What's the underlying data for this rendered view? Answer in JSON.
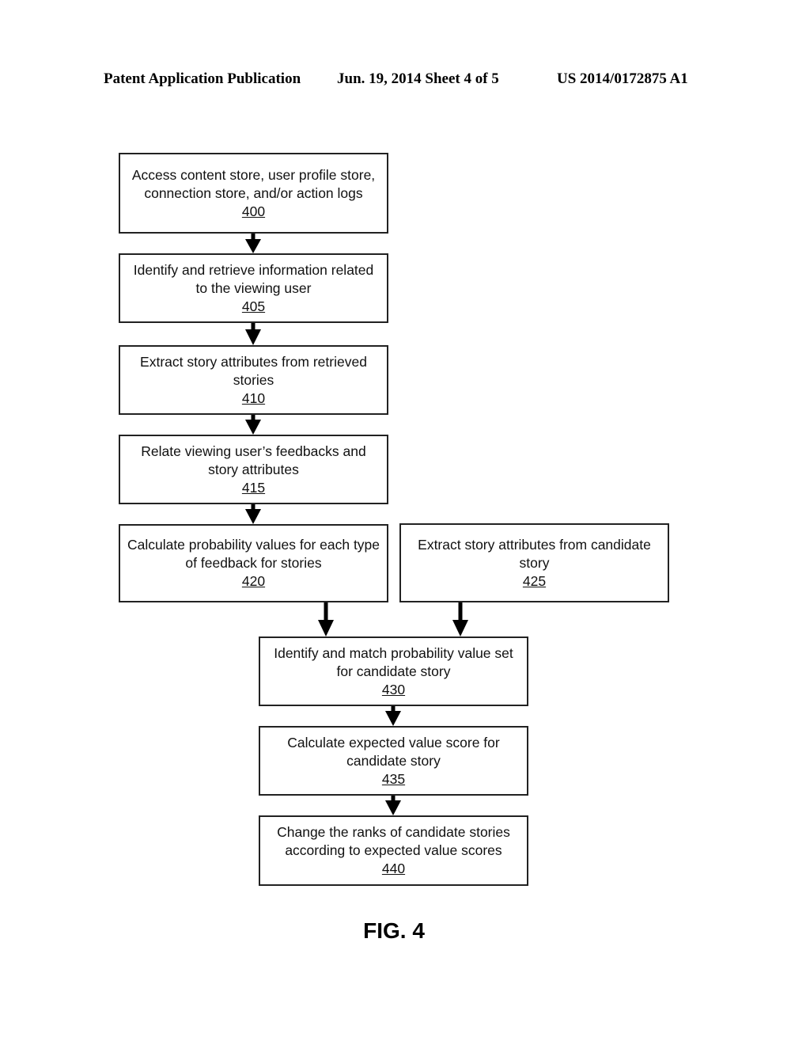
{
  "header": {
    "publication": "Patent Application Publication",
    "date_sheet": "Jun. 19, 2014  Sheet 4 of 5",
    "number": "US 2014/0172875 A1"
  },
  "steps": [
    {
      "id": "400",
      "text": "Access content store, user profile store, connection store, and/or action logs"
    },
    {
      "id": "405",
      "text": "Identify and retrieve information related to the viewing user"
    },
    {
      "id": "410",
      "text": "Extract story attributes from retrieved stories"
    },
    {
      "id": "415",
      "text": "Relate viewing user’s feedbacks and story attributes"
    },
    {
      "id": "420",
      "text": "Calculate probability values for each type of feedback for stories"
    },
    {
      "id": "425",
      "text": "Extract story attributes from candidate story"
    },
    {
      "id": "430",
      "text": "Identify and match probability value set for candidate story"
    },
    {
      "id": "435",
      "text": "Calculate expected value score for candidate story"
    },
    {
      "id": "440",
      "text": "Change the ranks of candidate stories according to expected value scores"
    }
  ],
  "edges": [
    [
      "400",
      "405"
    ],
    [
      "405",
      "410"
    ],
    [
      "410",
      "415"
    ],
    [
      "415",
      "420"
    ],
    [
      "420",
      "430"
    ],
    [
      "425",
      "430"
    ],
    [
      "430",
      "435"
    ],
    [
      "435",
      "440"
    ]
  ],
  "figure_label": "FIG. 4"
}
